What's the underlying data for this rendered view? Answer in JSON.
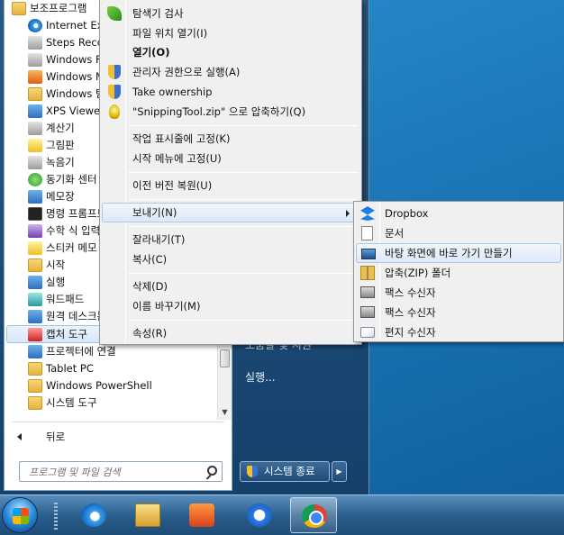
{
  "programs": [
    {
      "label": "보조프로그램",
      "icon": "folder-icon",
      "top": true
    },
    {
      "label": "Internet Explorer",
      "icon": "internet-explorer-icon"
    },
    {
      "label": "Steps Recorder",
      "icon": "steps-recorder-icon"
    },
    {
      "label": "Windows Fax and Scan",
      "icon": "fax-scan-icon"
    },
    {
      "label": "Windows Media Player",
      "icon": "media-player-icon"
    },
    {
      "label": "Windows 탐색기",
      "icon": "explorer-icon"
    },
    {
      "label": "XPS Viewer",
      "icon": "xps-viewer-icon"
    },
    {
      "label": "계산기",
      "icon": "calculator-icon"
    },
    {
      "label": "그림판",
      "icon": "paint-icon"
    },
    {
      "label": "녹음기",
      "icon": "sound-recorder-icon"
    },
    {
      "label": "동기화 센터",
      "icon": "sync-center-icon"
    },
    {
      "label": "메모장",
      "icon": "notepad-icon"
    },
    {
      "label": "명령 프롬프트",
      "icon": "command-prompt-icon"
    },
    {
      "label": "수학 식 입력판",
      "icon": "math-input-icon"
    },
    {
      "label": "스티커 메모",
      "icon": "sticky-notes-icon"
    },
    {
      "label": "시작",
      "icon": "getting-started-icon"
    },
    {
      "label": "실행",
      "icon": "run-icon"
    },
    {
      "label": "워드패드",
      "icon": "wordpad-icon"
    },
    {
      "label": "원격 데스크톱 연결",
      "icon": "remote-desktop-icon"
    },
    {
      "label": "캡처 도구",
      "icon": "snipping-tool-icon",
      "selected": true
    },
    {
      "label": "프로젝터에 연결",
      "icon": "projector-icon"
    },
    {
      "label": "Tablet PC",
      "icon": "folder-icon"
    },
    {
      "label": "Windows PowerShell",
      "icon": "folder-icon"
    },
    {
      "label": "시스템 도구",
      "icon": "folder-icon"
    }
  ],
  "back_label": "뒤로",
  "search_placeholder": "프로그램 및 파일 검색",
  "right_pane": {
    "partial_text": "도움말 및 지원",
    "run_label": "실행..."
  },
  "shutdown_label": "시스템 종료",
  "context_menu": [
    {
      "label": "탐색기 검사",
      "icon": "leaf-icon"
    },
    {
      "label": "파일 위치 열기(I)"
    },
    {
      "label": "열기(O)",
      "bold": true
    },
    {
      "label": "관리자 권한으로 실행(A)",
      "icon": "uac-shield-icon"
    },
    {
      "label": "Take ownership",
      "icon": "uac-shield-icon"
    },
    {
      "label": "\"SnippingTool.zip\" 으로 압축하기(Q)",
      "icon": "bulb-icon"
    },
    {
      "label": "작업 표시줄에 고정(K)"
    },
    {
      "label": "시작 메뉴에 고정(U)"
    },
    {
      "label": "이전 버전 복원(U)"
    },
    {
      "label": "보내기(N)",
      "submenu": true,
      "highlighted": true
    },
    {
      "label": "잘라내기(T)"
    },
    {
      "label": "복사(C)"
    },
    {
      "label": "삭제(D)"
    },
    {
      "label": "이름 바꾸기(M)"
    },
    {
      "label": "속성(R)"
    }
  ],
  "send_to_menu": [
    {
      "label": "Dropbox",
      "icon": "dropbox-icon"
    },
    {
      "label": "문서",
      "icon": "documents-icon"
    },
    {
      "label": "바탕 화면에 바로 가기 만들기",
      "icon": "desktop-icon",
      "highlighted": true
    },
    {
      "label": "압축(ZIP) 폴더",
      "icon": "zip-folder-icon"
    },
    {
      "label": "팩스 수신자",
      "icon": "fax-icon"
    },
    {
      "label": "팩스 수신자",
      "icon": "fax-icon"
    },
    {
      "label": "편지 수신자",
      "icon": "mail-icon"
    }
  ],
  "taskbar": [
    {
      "name": "internet-explorer"
    },
    {
      "name": "windows-explorer"
    },
    {
      "name": "media-player"
    },
    {
      "name": "sync"
    },
    {
      "name": "chrome",
      "active": true
    }
  ]
}
